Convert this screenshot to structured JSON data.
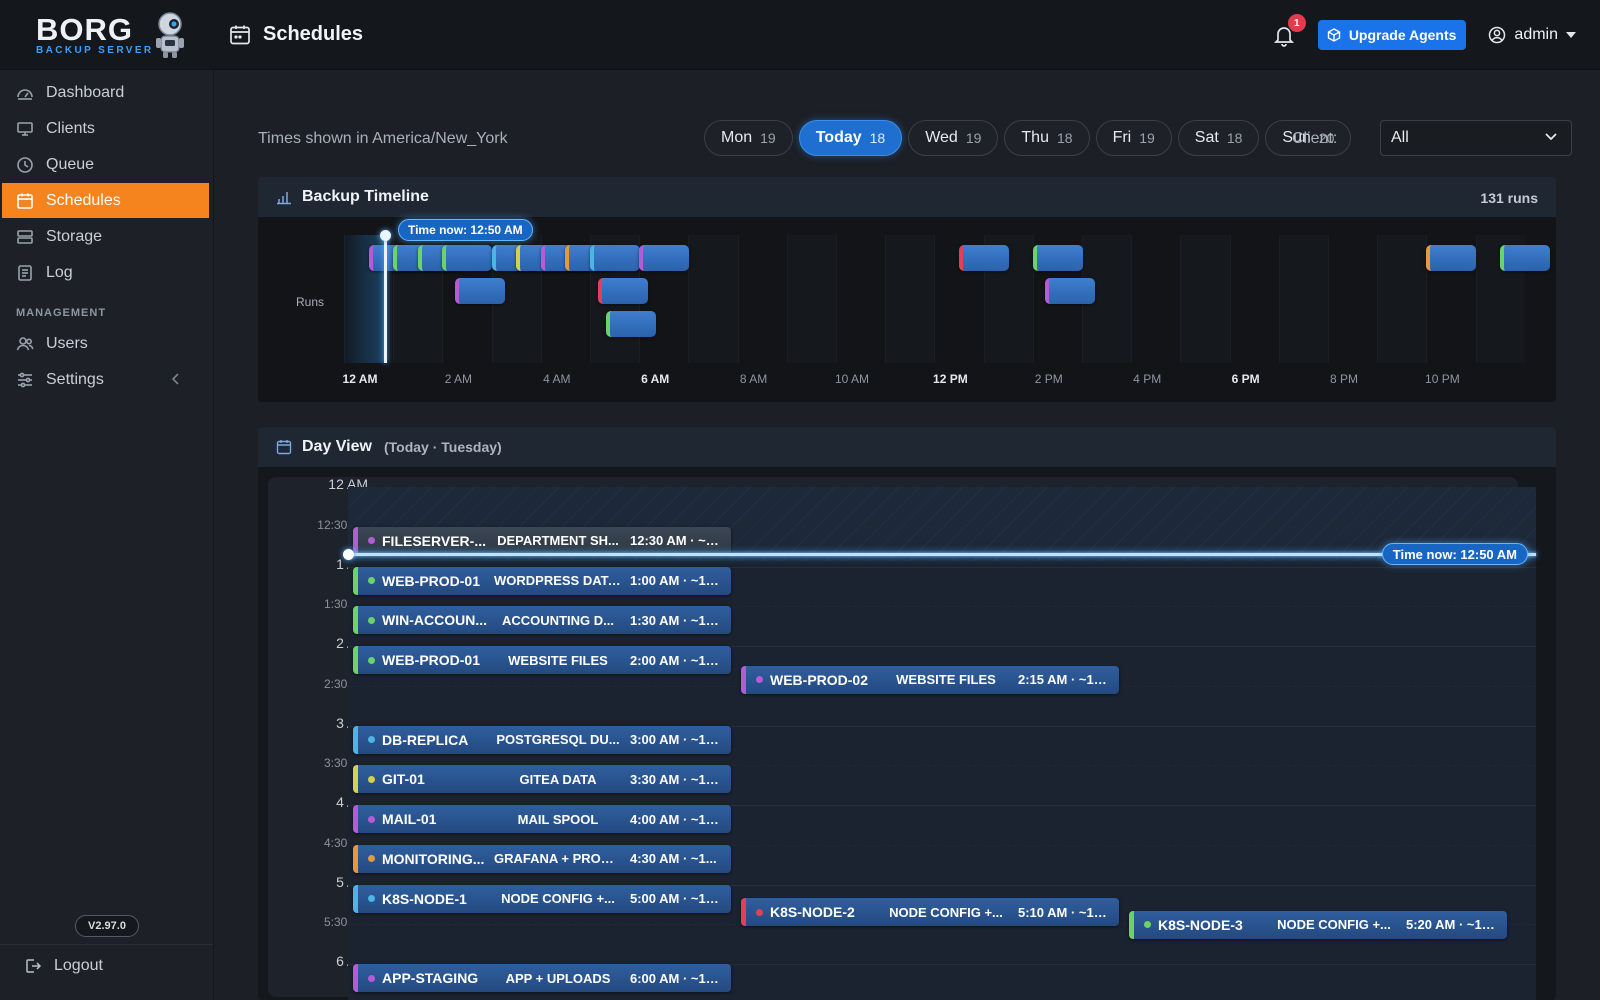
{
  "brand": {
    "name": "BORG",
    "subtitle": "BACKUP SERVER"
  },
  "header": {
    "page_title": "Schedules",
    "notification_count": "1",
    "upgrade_label": "Upgrade Agents",
    "user_label": "admin"
  },
  "sidebar": {
    "items": [
      {
        "label": "Dashboard",
        "icon": "dashboard-icon"
      },
      {
        "label": "Clients",
        "icon": "monitor-icon"
      },
      {
        "label": "Queue",
        "icon": "clock-icon"
      },
      {
        "label": "Schedules",
        "icon": "calendar-icon",
        "active": true
      },
      {
        "label": "Storage",
        "icon": "storage-icon"
      },
      {
        "label": "Log",
        "icon": "log-icon"
      }
    ],
    "section_title": "MANAGEMENT",
    "management_items": [
      {
        "label": "Users",
        "icon": "users-icon"
      },
      {
        "label": "Settings",
        "icon": "settings-icon"
      }
    ],
    "version": "V2.97.0",
    "logout_label": "Logout"
  },
  "filters": {
    "timezone_text": "Times shown in America/New_York",
    "days": [
      {
        "label": "Mon",
        "count": "19"
      },
      {
        "label": "Today",
        "count": "18",
        "active": true
      },
      {
        "label": "Wed",
        "count": "19"
      },
      {
        "label": "Thu",
        "count": "18"
      },
      {
        "label": "Fri",
        "count": "19"
      },
      {
        "label": "Sat",
        "count": "18"
      },
      {
        "label": "Sun",
        "count": "20"
      }
    ],
    "client_label": "Client:",
    "client_value": "All"
  },
  "timeline": {
    "title": "Backup Timeline",
    "runs_count": "131 runs",
    "runs_label": "Runs",
    "now_label": "Time now: 12:50 AM",
    "now_hour": 0.833,
    "axis_labels": [
      {
        "label": "12 AM",
        "hour": 0,
        "bold": true
      },
      {
        "label": "2 AM",
        "hour": 2
      },
      {
        "label": "4 AM",
        "hour": 4
      },
      {
        "label": "6 AM",
        "hour": 6,
        "bold": true
      },
      {
        "label": "8 AM",
        "hour": 8
      },
      {
        "label": "10 AM",
        "hour": 10
      },
      {
        "label": "12 PM",
        "hour": 12,
        "bold": true
      },
      {
        "label": "2 PM",
        "hour": 14
      },
      {
        "label": "4 PM",
        "hour": 16
      },
      {
        "label": "6 PM",
        "hour": 18,
        "bold": true
      },
      {
        "label": "8 PM",
        "hour": 20
      },
      {
        "label": "10 PM",
        "hour": 22
      }
    ],
    "runs": [
      {
        "hour": 0.5,
        "row": 0,
        "color": "#b45cd6"
      },
      {
        "hour": 1.0,
        "row": 0,
        "color": "#6ad36a"
      },
      {
        "hour": 1.5,
        "row": 0,
        "color": "#6ad36a"
      },
      {
        "hour": 2.0,
        "row": 0,
        "color": "#6ad36a"
      },
      {
        "hour": 2.25,
        "row": 1,
        "color": "#b45cd6"
      },
      {
        "hour": 3.0,
        "row": 0,
        "color": "#4cb5e6"
      },
      {
        "hour": 3.5,
        "row": 0,
        "color": "#d6d14c"
      },
      {
        "hour": 4.0,
        "row": 0,
        "color": "#b45cd6"
      },
      {
        "hour": 4.5,
        "row": 0,
        "color": "#e29a3b"
      },
      {
        "hour": 5.0,
        "row": 0,
        "color": "#4cb5e6"
      },
      {
        "hour": 5.17,
        "row": 1,
        "color": "#e2405a"
      },
      {
        "hour": 5.33,
        "row": 2,
        "color": "#6ad36a"
      },
      {
        "hour": 6.0,
        "row": 0,
        "color": "#b45cd6"
      },
      {
        "hour": 12.5,
        "row": 0,
        "color": "#e2405a"
      },
      {
        "hour": 14.0,
        "row": 0,
        "color": "#6ad36a"
      },
      {
        "hour": 14.25,
        "row": 1,
        "color": "#b45cd6"
      },
      {
        "hour": 22.0,
        "row": 0,
        "color": "#e29a3b"
      },
      {
        "hour": 23.5,
        "row": 0,
        "color": "#6ad36a"
      }
    ]
  },
  "dayview": {
    "title": "Day View",
    "subtitle": "(Today · Tuesday)",
    "now_label": "Time now: 12:50 AM",
    "now_hour": 0.833,
    "hour_labels": [
      "12 AM",
      "1 AM",
      "2 AM",
      "3 AM",
      "4 AM",
      "5 AM",
      "6 AM"
    ],
    "half_labels": [
      "12:30 AM",
      "1:30 AM",
      "2:30 AM",
      "3:30 AM",
      "4:30 AM",
      "5:30 AM"
    ],
    "jobs": [
      {
        "name": "FILESERVER-...",
        "desc": "DEPARTMENT SH...",
        "time": "12:30 AM · ~26...",
        "hour": 0.5,
        "col": 0,
        "color": "#b45cd6",
        "past": true
      },
      {
        "name": "WEB-PROD-01",
        "desc": "WORDPRESS DATA...",
        "time": "1:00 AM · ~15...",
        "hour": 1.0,
        "col": 0,
        "color": "#6ad36a"
      },
      {
        "name": "WIN-ACCOUN...",
        "desc": "ACCOUNTING D...",
        "time": "1:30 AM · ~15...",
        "hour": 1.5,
        "col": 0,
        "color": "#6ad36a"
      },
      {
        "name": "WEB-PROD-01",
        "desc": "WEBSITE FILES",
        "time": "2:00 AM · ~15...",
        "hour": 2.0,
        "col": 0,
        "color": "#6ad36a"
      },
      {
        "name": "WEB-PROD-02",
        "desc": "WEBSITE FILES",
        "time": "2:15 AM · ~15...",
        "hour": 2.25,
        "col": 1,
        "color": "#b45cd6"
      },
      {
        "name": "DB-REPLICA",
        "desc": "POSTGRESQL DU...",
        "time": "3:00 AM · ~15...",
        "hour": 3.0,
        "col": 0,
        "color": "#4cb5e6"
      },
      {
        "name": "GIT-01",
        "desc": "GITEA DATA",
        "time": "3:30 AM · ~15...",
        "hour": 3.5,
        "col": 0,
        "color": "#d6d14c"
      },
      {
        "name": "MAIL-01",
        "desc": "MAIL SPOOL",
        "time": "4:00 AM · ~16...",
        "hour": 4.0,
        "col": 0,
        "color": "#b45cd6"
      },
      {
        "name": "MONITORING...",
        "desc": "GRAFANA + PROME...",
        "time": "4:30 AM · ~1...",
        "hour": 4.5,
        "col": 0,
        "color": "#e29a3b"
      },
      {
        "name": "K8S-NODE-1",
        "desc": "NODE CONFIG +...",
        "time": "5:00 AM · ~15...",
        "hour": 5.0,
        "col": 0,
        "color": "#4cb5e6"
      },
      {
        "name": "K8S-NODE-2",
        "desc": "NODE CONFIG +...",
        "time": "5:10 AM · ~15...",
        "hour": 5.17,
        "col": 1,
        "color": "#e2405a"
      },
      {
        "name": "K8S-NODE-3",
        "desc": "NODE CONFIG +...",
        "time": "5:20 AM · ~15...",
        "hour": 5.33,
        "col": 2,
        "color": "#6ad36a"
      },
      {
        "name": "APP-STAGING",
        "desc": "APP + UPLOADS",
        "time": "6:00 AM · ~15m...",
        "hour": 6.0,
        "col": 0,
        "color": "#b45cd6"
      }
    ]
  }
}
